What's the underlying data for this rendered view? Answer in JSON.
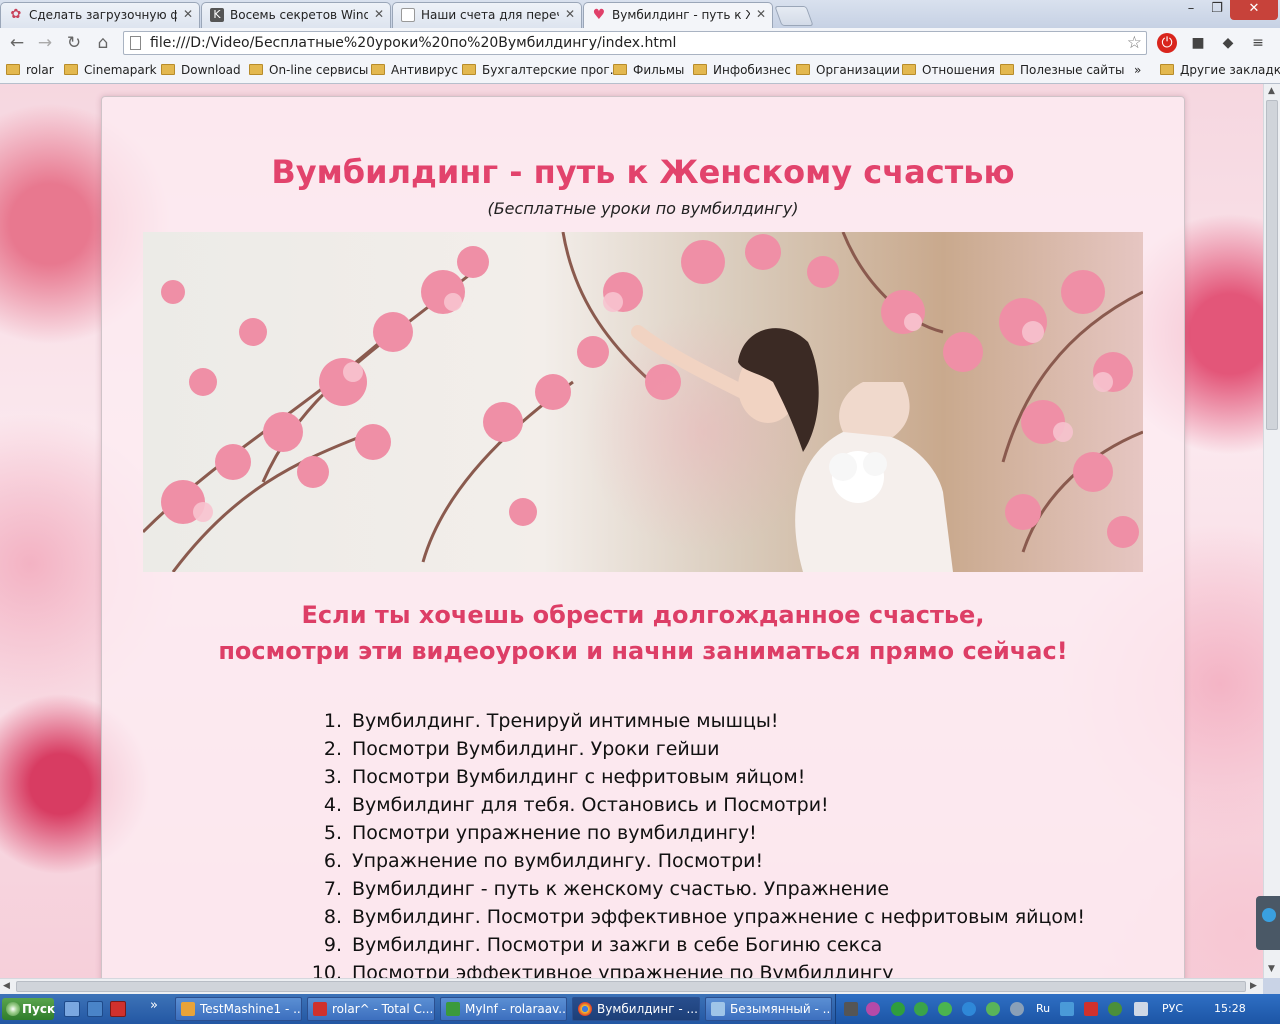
{
  "tabs": [
    {
      "title": "Сделать загрузочную фл",
      "favicon_color": "#c8435b",
      "active": false
    },
    {
      "title": "Восемь секретов Window",
      "favicon_color": "#555555",
      "active": false
    },
    {
      "title": "Наши счета для перечис",
      "favicon_color": "#ffffff",
      "active": false
    },
    {
      "title": "Вумбилдинг - путь к Жен",
      "favicon_color": "#e0406a",
      "active": true
    }
  ],
  "address_bar": {
    "url": "file:///D:/Video/Бесплатные%20уроки%20по%20Вумбилдингу/index.html"
  },
  "bookmarks": {
    "items": [
      "rolar",
      "Cinemapark",
      "Download",
      "On-line сервисы",
      "Антивирус",
      "Бухгалтерские прог...",
      "Фильмы",
      "Инфобизнес",
      "Организации",
      "Отношения",
      "Полезные сайты"
    ],
    "overflow": "»",
    "other": "Другие закладки"
  },
  "page": {
    "title": "Вумбилдинг - путь к Женскому счастью",
    "subtitle": "(Бесплатные уроки по вумбилдингу)",
    "headline_line1": "Если ты хочешь обрести долгожданное счастье,",
    "headline_line2": "посмотри эти видеоуроки и начни заниматься прямо сейчас!",
    "lessons": [
      "Вумбилдинг. Тренируй интимные мышцы!",
      "Посмотри Вумбилдинг. Уроки гейши",
      "Посмотри Вумбилдинг с нефритовым яйцом!",
      "Вумбилдинг для тебя. Остановись и Посмотри!",
      "Посмотри упражнение по вумбилдингу!",
      "Упражнение по вумбилдингу. Посмотри!",
      "Вумбилдинг - путь к женскому счастью. Упражнение",
      "Вумбилдинг. Посмотри эффективное упражнение с нефритовым яйцом!",
      "Вумбилдинг. Посмотри и зажги в себе Богиню секса",
      "Посмотри эффективное упражнение по Вумбилдингу"
    ]
  },
  "taskbar": {
    "start_label": "Пуск",
    "tasks": [
      {
        "label": "TestMashine1 - ...",
        "icon_color": "#e8a33a",
        "active": false
      },
      {
        "label": "rolar^ - Total C...",
        "icon_color": "#d0312d",
        "active": false
      },
      {
        "label": "MyInf - rolaraav...",
        "icon_color": "#3b9a3b",
        "active": false
      },
      {
        "label": "Вумбилдинг - ...",
        "icon_color": "#f1c232",
        "active": true
      },
      {
        "label": "Безымянный - ...",
        "icon_color": "#9fc5e8",
        "active": false
      }
    ],
    "overflow": "»",
    "lang_short": "Ru",
    "lang": "РУС",
    "clock": "15:28"
  },
  "colors": {
    "accent": "#e2436c",
    "headline": "#dd3e66"
  }
}
